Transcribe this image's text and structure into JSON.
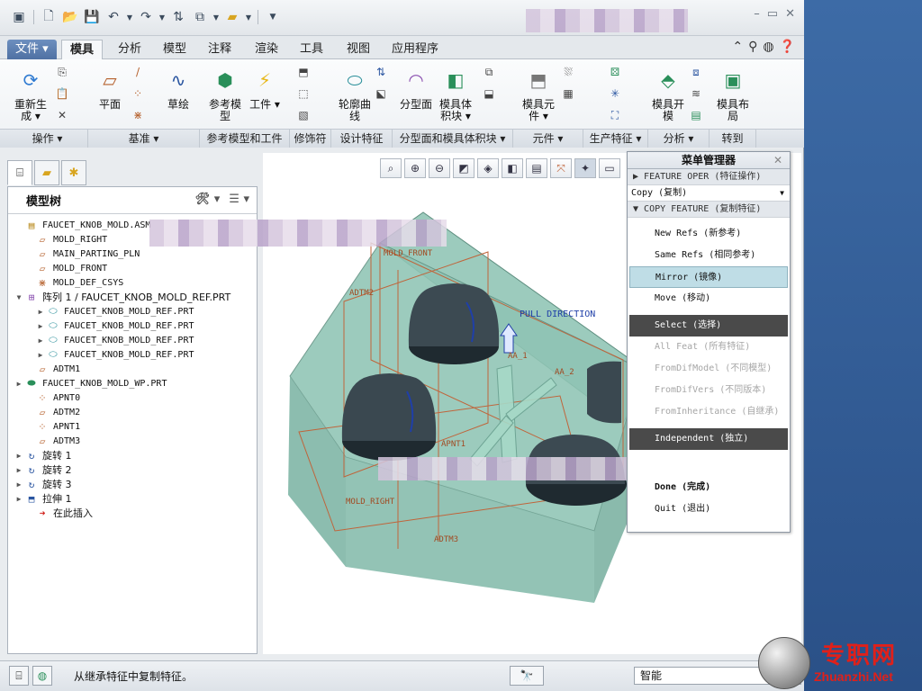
{
  "titlebar": {
    "quick_access": [
      "app-icon",
      "new-icon",
      "open-icon",
      "save-icon",
      "undo-icon",
      "redo-icon",
      "regenerate-icon",
      "windows-icon",
      "folder-icon",
      "customize-icon"
    ],
    "window_controls": [
      "–",
      "▭",
      "✕"
    ]
  },
  "tabs": {
    "file": "文件",
    "items": [
      "模具",
      "分析",
      "模型",
      "注释",
      "渲染",
      "工具",
      "视图",
      "应用程序"
    ],
    "active": "模具"
  },
  "ribbon": {
    "buttons": {
      "regenerate": "重新生成",
      "plane": "平面",
      "sketch": "草绘",
      "ref_model": "参考模型",
      "workpiece": "工件",
      "silhouette": "轮廓曲线",
      "parting_surface": "分型面",
      "mold_volume": "模具体积块",
      "mold_component": "模具元件",
      "mold_open": "模具开模",
      "mold_layout": "模具布局"
    },
    "groups": [
      "操作",
      "基准",
      "参考模型和工件",
      "修饰符",
      "设计特征",
      "分型面和模具体积块",
      "元件",
      "生产特征",
      "分析",
      "转到"
    ]
  },
  "model_tree": {
    "title": "模型树",
    "items": [
      {
        "label": "FAUCET_KNOB_MOLD.ASM",
        "indent": 0,
        "twisty": "",
        "icon": "assembly-icon"
      },
      {
        "label": "MOLD_RIGHT",
        "indent": 1,
        "twisty": "",
        "icon": "datum-plane-icon"
      },
      {
        "label": "MAIN_PARTING_PLN",
        "indent": 1,
        "twisty": "",
        "icon": "datum-plane-icon"
      },
      {
        "label": "MOLD_FRONT",
        "indent": 1,
        "twisty": "",
        "icon": "datum-plane-icon"
      },
      {
        "label": "MOLD_DEF_CSYS",
        "indent": 1,
        "twisty": "",
        "icon": "csys-icon"
      },
      {
        "label": "阵列 1 / FAUCET_KNOB_MOLD_REF.PRT",
        "indent": 0,
        "twisty": "▼",
        "icon": "pattern-icon"
      },
      {
        "label": "FAUCET_KNOB_MOLD_REF.PRT",
        "indent": 2,
        "twisty": "▶",
        "icon": "part-icon"
      },
      {
        "label": "FAUCET_KNOB_MOLD_REF.PRT",
        "indent": 2,
        "twisty": "▶",
        "icon": "part-icon"
      },
      {
        "label": "FAUCET_KNOB_MOLD_REF.PRT",
        "indent": 2,
        "twisty": "▶",
        "icon": "part-icon"
      },
      {
        "label": "FAUCET_KNOB_MOLD_REF.PRT",
        "indent": 2,
        "twisty": "▶",
        "icon": "part-icon"
      },
      {
        "label": "ADTM1",
        "indent": 1,
        "twisty": "",
        "icon": "datum-plane-icon"
      },
      {
        "label": "FAUCET_KNOB_MOLD_WP.PRT",
        "indent": 0,
        "twisty": "▶",
        "icon": "workpiece-icon"
      },
      {
        "label": "APNT0",
        "indent": 1,
        "twisty": "",
        "icon": "datum-point-icon"
      },
      {
        "label": "ADTM2",
        "indent": 1,
        "twisty": "",
        "icon": "datum-plane-icon"
      },
      {
        "label": "APNT1",
        "indent": 1,
        "twisty": "",
        "icon": "datum-point-icon"
      },
      {
        "label": "ADTM3",
        "indent": 1,
        "twisty": "",
        "icon": "datum-plane-icon"
      },
      {
        "label": "旋转 1",
        "indent": 0,
        "twisty": "▶",
        "icon": "revolve-icon"
      },
      {
        "label": "旋转 2",
        "indent": 0,
        "twisty": "▶",
        "icon": "revolve-icon"
      },
      {
        "label": "旋转 3",
        "indent": 0,
        "twisty": "▶",
        "icon": "revolve-icon"
      },
      {
        "label": "拉伸 1",
        "indent": 0,
        "twisty": "▶",
        "icon": "extrude-icon"
      },
      {
        "label": "在此插入",
        "indent": 1,
        "twisty": "",
        "icon": "insert-here-icon"
      }
    ]
  },
  "viewbar": [
    "refit-icon",
    "zoom-in-icon",
    "zoom-out-icon",
    "repaint-icon",
    "saved-views-icon",
    "display-style-icon",
    "view-manager-icon",
    "datum-display-icon",
    "spin-center-icon",
    "annotation-display-icon"
  ],
  "model_labels": {
    "mold_front": "MOLD_FRONT",
    "adtm2": "ADTM2",
    "pull_direction": "PULL DIRECTION",
    "aa1": "AA_1",
    "aa2": "AA_2",
    "apnt1": "APNT1",
    "mold_right": "MOLD_RIGHT",
    "adtm3": "ADTM3"
  },
  "menu_manager": {
    "title": "菜单管理器",
    "feature_oper": "FEATURE OPER (特征操作)",
    "copy_line": "Copy (复制)",
    "copy_feature": "COPY FEATURE (复制特征)",
    "items": {
      "new_refs": "New Refs (新参考)",
      "same_refs": "Same Refs (相同参考)",
      "mirror": "Mirror (镜像)",
      "move": "Move (移动)",
      "select": "Select (选择)",
      "all_feat": "All Feat (所有特征)",
      "from_dif_model": "FromDifModel (不同模型)",
      "from_dif_vers": "FromDifVers (不同版本)",
      "from_inheritance": "FromInheritance (自继承)",
      "independent": "Independent (独立)",
      "done": "Done (完成)",
      "quit": "Quit (退出)"
    }
  },
  "statusbar": {
    "message": "从继承特征中复制特征。",
    "filter": "智能"
  },
  "watermark": {
    "text_cn": "专职网",
    "text_en": "Zhuanzhi.Net"
  },
  "colors": {
    "workpiece": "#8fc4b4",
    "datum": "#c0643a",
    "selection_dark": "#4a4a4a",
    "highlight": "#bfdde6",
    "brand_red": "#e0201a"
  }
}
